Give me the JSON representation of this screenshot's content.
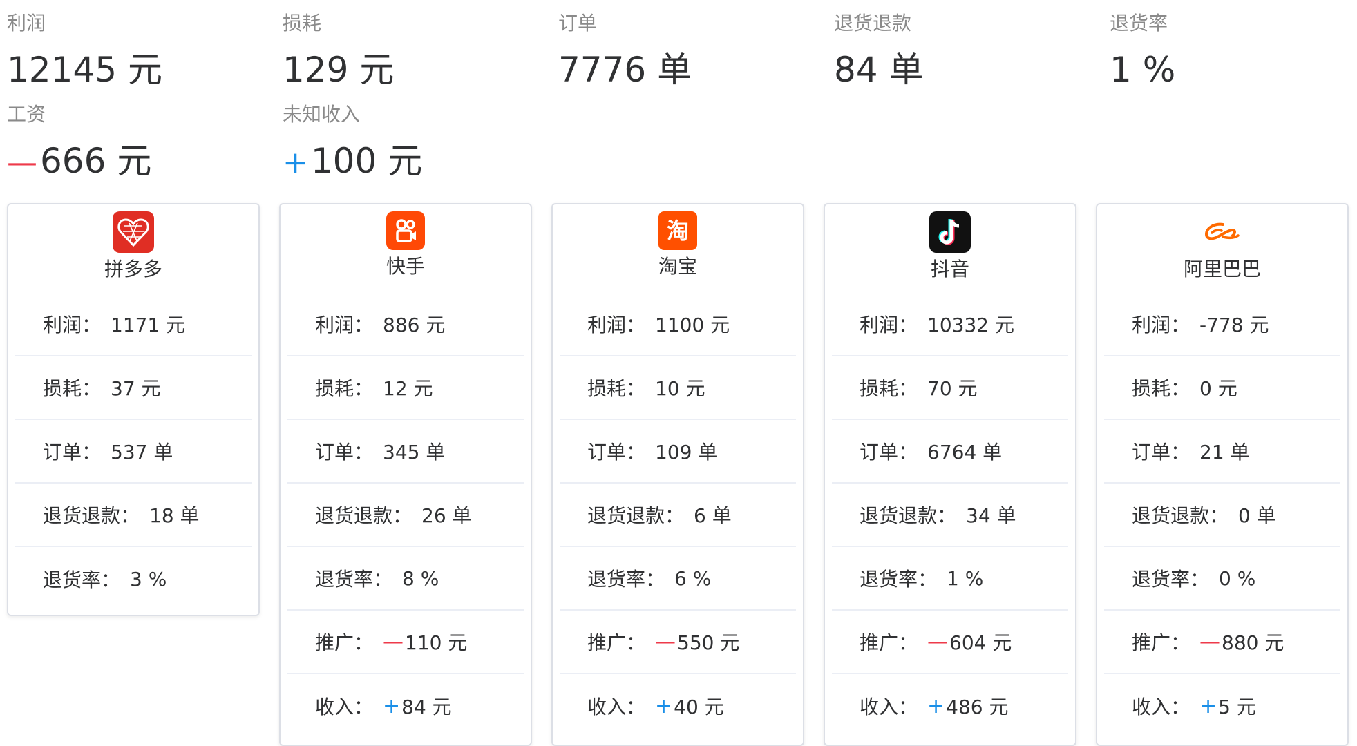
{
  "summary": {
    "profit": {
      "label": "利润",
      "value": "12145",
      "unit": "元"
    },
    "loss": {
      "label": "损耗",
      "value": "129",
      "unit": "元"
    },
    "orders": {
      "label": "订单",
      "value": "7776",
      "unit": "单"
    },
    "returns": {
      "label": "退货退款",
      "value": "84",
      "unit": "单"
    },
    "return_rate": {
      "label": "退货率",
      "value": "1",
      "unit": "%"
    },
    "salary": {
      "label": "工资",
      "sign": "—",
      "value": "666",
      "unit": "元"
    },
    "unknown_income": {
      "label": "未知收入",
      "sign": "+",
      "value": "100",
      "unit": "元"
    }
  },
  "row_labels": {
    "profit": "利润：",
    "loss": "损耗：",
    "orders": "订单：",
    "returns": "退货退款：",
    "return_rate": "退货率：",
    "promotion": "推广：",
    "income": "收入："
  },
  "signs": {
    "minus": "—",
    "plus": "+"
  },
  "colors": {
    "minus": "#ee3a4a",
    "plus": "#1a8fe8",
    "border": "#dcdfe6"
  },
  "platforms": [
    {
      "name": "拼多多",
      "icon": "pinduoduo-logo",
      "logo_color": "#e02e24",
      "profit": "1171 元",
      "loss": "37 元",
      "orders": "537 单",
      "returns": "18 单",
      "return_rate": "3 %"
    },
    {
      "name": "快手",
      "icon": "kuaishou-logo",
      "logo_color": "#ff4906",
      "profit": "886 元",
      "loss": "12 元",
      "orders": "345 单",
      "returns": "26 单",
      "return_rate": "8 %",
      "promotion": "110 元",
      "income": "84 元"
    },
    {
      "name": "淘宝",
      "icon": "taobao-logo",
      "logo_color": "#ff5000",
      "logo_text": "淘",
      "profit": "1100 元",
      "loss": "10 元",
      "orders": "109 单",
      "returns": "6 单",
      "return_rate": "6 %",
      "promotion": "550 元",
      "income": "40 元"
    },
    {
      "name": "抖音",
      "icon": "douyin-logo",
      "logo_color": "#111111",
      "profit": "10332 元",
      "loss": "70 元",
      "orders": "6764 单",
      "returns": "34 单",
      "return_rate": "1 %",
      "promotion": "604 元",
      "income": "486 元"
    },
    {
      "name": "阿里巴巴",
      "icon": "alibaba-logo",
      "logo_color": "#ff6a00",
      "profit": "-778 元",
      "loss": "0 元",
      "orders": "21 单",
      "returns": "0 单",
      "return_rate": "0 %",
      "promotion": "880 元",
      "income": "5 元"
    }
  ]
}
